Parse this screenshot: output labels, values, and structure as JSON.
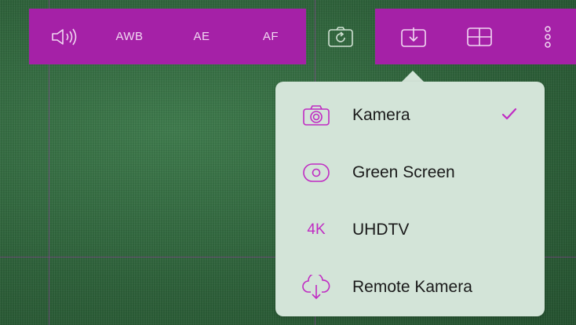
{
  "toolbar": {
    "items": [
      {
        "icon": "speaker-icon"
      },
      {
        "label": "AWB"
      },
      {
        "label": "AE"
      },
      {
        "label": "AF"
      },
      {
        "icon": "camera-rotate-icon"
      },
      {
        "icon": "download-icon"
      },
      {
        "icon": "grid-icon"
      },
      {
        "icon": "more-vertical-icon"
      }
    ],
    "accent_color": "#a521a7"
  },
  "menu": {
    "items": [
      {
        "label": "Kamera",
        "icon": "camera-icon",
        "selected": true
      },
      {
        "label": "Green Screen",
        "icon": "green-screen-icon",
        "selected": false
      },
      {
        "label": "UHDTV",
        "icon_text": "4K",
        "selected": false
      },
      {
        "label": "Remote Kamera",
        "icon": "cloud-download-icon",
        "selected": false
      }
    ],
    "accent_color": "#c02bc3",
    "background_color": "#d3e4d8"
  }
}
